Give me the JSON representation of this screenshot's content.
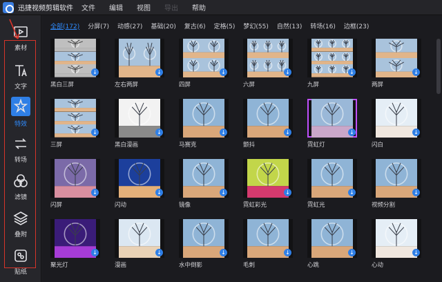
{
  "menubar": {
    "title": "迅捷视频剪辑软件",
    "items": [
      "文件",
      "编辑",
      "视图",
      "导出",
      "帮助"
    ]
  },
  "sidebar": {
    "items": [
      {
        "label": "素材",
        "icon": "media-icon"
      },
      {
        "label": "文字",
        "icon": "text-icon"
      },
      {
        "label": "特效",
        "icon": "effects-icon"
      },
      {
        "label": "转场",
        "icon": "transition-icon"
      },
      {
        "label": "滤镜",
        "icon": "filter-icon"
      },
      {
        "label": "叠附",
        "icon": "overlay-icon"
      },
      {
        "label": "贴纸",
        "icon": "sticker-icon"
      }
    ],
    "active_index": 2
  },
  "tabs": [
    {
      "label": "全部(172)",
      "active": true
    },
    {
      "label": "分屏(7)"
    },
    {
      "label": "动感(27)"
    },
    {
      "label": "基础(20)"
    },
    {
      "label": "复古(6)"
    },
    {
      "label": "定格(5)"
    },
    {
      "label": "梦幻(55)"
    },
    {
      "label": "自然(13)"
    },
    {
      "label": "转场(16)"
    },
    {
      "label": "边框(23)"
    }
  ],
  "effects": [
    {
      "label": "黑白三屏",
      "style": "tri-bw"
    },
    {
      "label": "左右两屏",
      "style": "two-h"
    },
    {
      "label": "四屏",
      "style": "quad"
    },
    {
      "label": "六屏",
      "style": "six"
    },
    {
      "label": "九屏",
      "style": "nine"
    },
    {
      "label": "两屏",
      "style": "two-v"
    },
    {
      "label": "三屏",
      "style": "tri"
    },
    {
      "label": "黑白漫画",
      "style": "bw-burst"
    },
    {
      "label": "马赛克",
      "style": "plain"
    },
    {
      "label": "颤抖",
      "style": "plain"
    },
    {
      "label": "霓虹灯",
      "style": "neon",
      "selected": true
    },
    {
      "label": "闪白",
      "style": "bright"
    },
    {
      "label": "闪屏",
      "style": "dusk"
    },
    {
      "label": "闪动",
      "style": "blue"
    },
    {
      "label": "镜像",
      "style": "plain"
    },
    {
      "label": "霓虹彩光",
      "style": "rainbow"
    },
    {
      "label": "霓虹光",
      "style": "plain"
    },
    {
      "label": "视频分割",
      "style": "plain"
    },
    {
      "label": "聚光灯",
      "style": "spot"
    },
    {
      "label": "漫画",
      "style": "burst"
    },
    {
      "label": "水中倒影",
      "style": "plain"
    },
    {
      "label": "毛刺",
      "style": "plain"
    },
    {
      "label": "心跳",
      "style": "plain"
    },
    {
      "label": "心动",
      "style": "bright"
    }
  ],
  "colors": {
    "accent": "#2f8cff",
    "annotation": "#d8342a",
    "neon": "#c050ff"
  }
}
